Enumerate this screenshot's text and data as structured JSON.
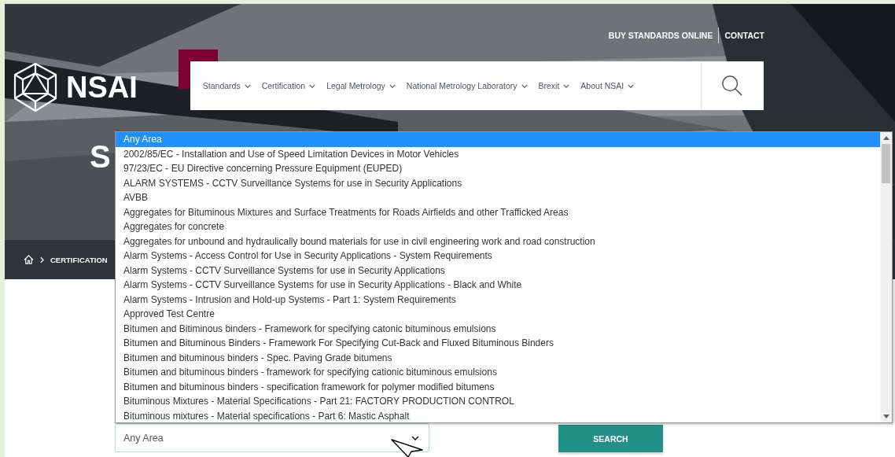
{
  "top_links": [
    "BUY STANDARDS ONLINE",
    "CONTACT"
  ],
  "logo": {
    "text": "NSAI"
  },
  "nav": [
    {
      "label": "Standards"
    },
    {
      "label": "Certification"
    },
    {
      "label": "Legal Metrology"
    },
    {
      "label": "National Metrology Laboratory"
    },
    {
      "label": "Brexit"
    },
    {
      "label": "About NSAI"
    }
  ],
  "heading": "S",
  "breadcrumb": [
    "CERTIFICATION"
  ],
  "dropdown": {
    "options": [
      {
        "label": "Any Area",
        "selected": true
      },
      {
        "label": "2002/85/EC - Installation and Use of Speed Limitation Devices in Motor Vehicles",
        "selected": false
      },
      {
        "label": "97/23/EC - EU Directive concerning Pressure Equipment (EUPED)",
        "selected": false
      },
      {
        "label": "ALARM SYSTEMS - CCTV Surveillance Systems for use in Security Applications",
        "selected": false
      },
      {
        "label": "AVBB",
        "selected": false
      },
      {
        "label": "Aggregates for Bituminous Mixtures and Surface Treatments for Roads Airfields and other Trafficked Areas",
        "selected": false
      },
      {
        "label": "Aggregates for concrete",
        "selected": false
      },
      {
        "label": "Aggregates for unbound and hydraulically bound materials for use in civil engineering work and road construction",
        "selected": false
      },
      {
        "label": "Alarm Systems - Access Control for Use in Security Applications - System Requirements",
        "selected": false
      },
      {
        "label": "Alarm Systems - CCTV Surveillance Systems for use in Security Applications",
        "selected": false
      },
      {
        "label": "Alarm Systems - CCTV Surveillance Systems for use in Security Applications - Black and White",
        "selected": false
      },
      {
        "label": "Alarm Systems - Intrusion and Hold-up Systems - Part 1: System Requirements",
        "selected": false
      },
      {
        "label": "Approved Test Centre",
        "selected": false
      },
      {
        "label": "Bitumen and Bitiminous binders - Framework for specifying catonic bituminous emulsions",
        "selected": false
      },
      {
        "label": "Bitumen and Bituminous Binders - Framework For Specifying Cut-Back and Fluxed Bituminous Binders",
        "selected": false
      },
      {
        "label": "Bitumen and bituminous binders - Spec. Paving Grade bitumens",
        "selected": false
      },
      {
        "label": "Bitumen and bituminous binders - framework for specifying cationic bituminous emulsions",
        "selected": false
      },
      {
        "label": "Bitumen and bituminous binders - specification framework for polymer modified bitumens",
        "selected": false
      },
      {
        "label": "Bituminous Mixtures - Material Specifications - Part 21: FACTORY PRODUCTION CONTROL",
        "selected": false
      },
      {
        "label": "Bituminous mixtures - Material specifications - Part 6: Mastic Asphalt",
        "selected": false
      }
    ]
  },
  "area_select": {
    "value": "Any Area"
  },
  "search_button": "SEARCH"
}
